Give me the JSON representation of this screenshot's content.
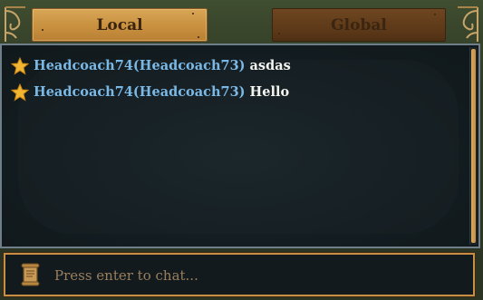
{
  "tabs": {
    "local_label": "Local",
    "global_label": "Global",
    "active": "Local"
  },
  "messages": [
    {
      "icon": "star-icon",
      "sender": "Headcoach74(Headcoach73)",
      "text": "asdas"
    },
    {
      "icon": "star-icon",
      "sender": "Headcoach74(Headcoach73)",
      "text": "Hello"
    }
  ],
  "input": {
    "placeholder": "Press enter to chat...",
    "value": "",
    "icon": "scroll-icon"
  },
  "colors": {
    "sender": "#7ab8e6",
    "message_text": "#f4f4f0",
    "active_tab": "#d8a656",
    "inactive_tab": "#6e4620",
    "accent_border": "#c88e45"
  }
}
